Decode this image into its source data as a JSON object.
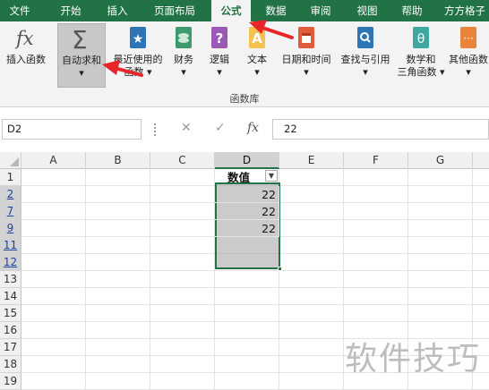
{
  "tabs": [
    "文件",
    "开始",
    "插入",
    "页面布局",
    "公式",
    "数据",
    "审阅",
    "视图",
    "帮助",
    "方方格子"
  ],
  "active_tab": "公式",
  "ribbon": {
    "buttons": [
      {
        "label": "插入函数",
        "label2": "",
        "icon": "fx-icon"
      },
      {
        "label": "自动求和",
        "label2": "▾",
        "icon": "sigma-icon"
      },
      {
        "label": "最近使用的",
        "label2": "函数 ▾",
        "icon": "star-book-icon"
      },
      {
        "label": "财务",
        "label2": "▾",
        "icon": "coins-book-icon"
      },
      {
        "label": "逻辑",
        "label2": "▾",
        "icon": "question-book-icon"
      },
      {
        "label": "文本",
        "label2": "▾",
        "icon": "text-book-icon"
      },
      {
        "label": "日期和时间",
        "label2": "▾",
        "icon": "calendar-book-icon"
      },
      {
        "label": "查找与引用",
        "label2": "▾",
        "icon": "search-book-icon"
      },
      {
        "label": "数学和",
        "label2": "三角函数 ▾",
        "icon": "theta-book-icon"
      },
      {
        "label": "其他函数",
        "label2": "▾",
        "icon": "more-book-icon"
      }
    ],
    "group_label": "函数库"
  },
  "formula_bar": {
    "name_box": "D2",
    "cancel_glyph": "✕",
    "enter_glyph": "✓",
    "fx_glyph": "fx",
    "formula_value": "22"
  },
  "columns": [
    "A",
    "B",
    "C",
    "D",
    "E",
    "F",
    "G"
  ],
  "rows": [
    "1",
    "2",
    "7",
    "9",
    "11",
    "12",
    "13",
    "14",
    "15",
    "16",
    "17",
    "18",
    "19"
  ],
  "cells": {
    "D1": "数值",
    "D2": "22",
    "D7": "22",
    "D9": "22"
  },
  "watermark": "软件技巧",
  "colors": {
    "accent": "#217346",
    "arrow": "#e8262a"
  }
}
